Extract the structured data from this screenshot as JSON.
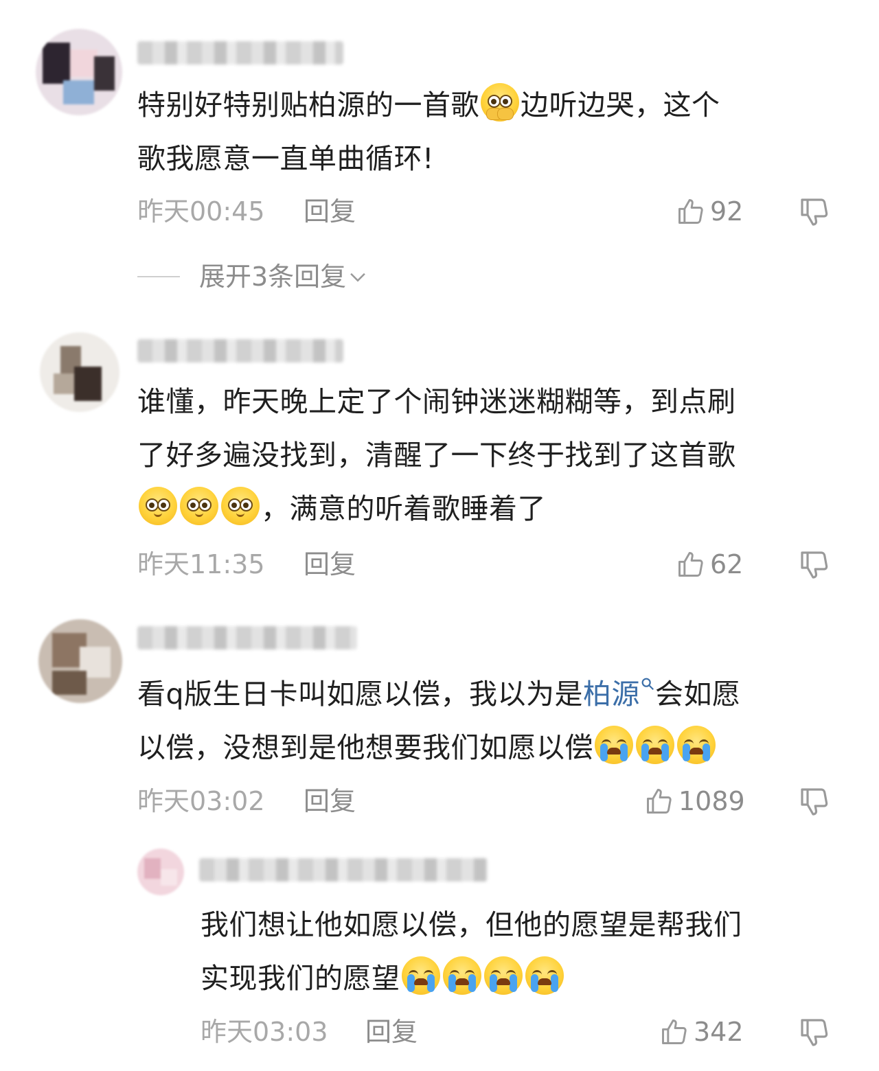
{
  "comments": [
    {
      "text_parts": [
        "特别好特别贴柏源的一首歌",
        "边听边哭，这个",
        "歌我愿意一直单曲循环!"
      ],
      "emoji": "pleading-hands-emoji",
      "time": "昨天00:45",
      "reply_label": "回复",
      "likes": "92",
      "expand_label": "展开3条回复"
    },
    {
      "text_parts": [
        "谁懂，昨天晚上定了个闹钟迷迷糊糊等，到点刷",
        "了好多遍没找到，清醒了一下终于找到了这首歌",
        "，满意的听着歌睡着了"
      ],
      "emoji": "pleading-emoji",
      "time": "昨天11:35",
      "reply_label": "回复",
      "likes": "62"
    },
    {
      "text_parts": [
        "看q版生日卡叫如愿以偿，我以为是",
        "柏源",
        "会如愿",
        "以偿，没想到是他想要我们如愿以偿"
      ],
      "emoji": "crying-emoji",
      "time": "昨天03:02",
      "reply_label": "回复",
      "likes": "1089"
    },
    {
      "text_parts": [
        "我们想让他如愿以偿，但他的愿望是帮我们",
        "实现我们的愿望"
      ],
      "emoji": "crying-emoji",
      "time": "昨天03:03",
      "reply_label": "回复",
      "likes": "342"
    }
  ],
  "colors": {
    "link": "#3b6ea8",
    "meta": "#a8a8a8",
    "text": "#1f1f1f"
  },
  "icons": [
    "thumbs-up-icon",
    "thumbs-down-icon",
    "search-icon",
    "chevron-down-icon"
  ]
}
